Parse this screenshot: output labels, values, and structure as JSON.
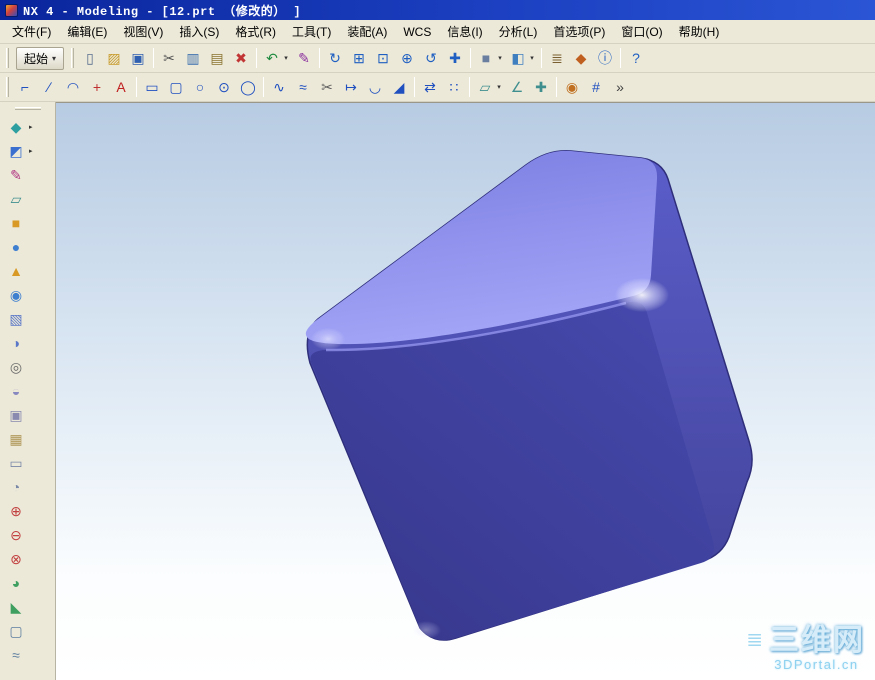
{
  "window": {
    "title": "NX 4 - Modeling - [12.prt （修改的） ]"
  },
  "menubar": {
    "items": [
      {
        "name": "menu-file",
        "label": "文件(F)"
      },
      {
        "name": "menu-edit",
        "label": "编辑(E)"
      },
      {
        "name": "menu-view",
        "label": "视图(V)"
      },
      {
        "name": "menu-insert",
        "label": "插入(S)"
      },
      {
        "name": "menu-format",
        "label": "格式(R)"
      },
      {
        "name": "menu-tools",
        "label": "工具(T)"
      },
      {
        "name": "menu-assemblies",
        "label": "装配(A)"
      },
      {
        "name": "menu-wcs",
        "label": "WCS"
      },
      {
        "name": "menu-information",
        "label": "信息(I)"
      },
      {
        "name": "menu-analysis",
        "label": "分析(L)"
      },
      {
        "name": "menu-preferences",
        "label": "首选项(P)"
      },
      {
        "name": "menu-window",
        "label": "窗口(O)"
      },
      {
        "name": "menu-help",
        "label": "帮助(H)"
      }
    ]
  },
  "toolbar_top": {
    "start_label": "起始",
    "start_arrow": "▾",
    "row1": [
      {
        "name": "new-button",
        "glyph": "▯",
        "color": "#5b7090"
      },
      {
        "name": "open-button",
        "glyph": "▨",
        "color": "#c89b2a"
      },
      {
        "name": "save-button",
        "glyph": "▣",
        "color": "#2f5fb0"
      },
      {
        "sep": true
      },
      {
        "name": "cut-button",
        "glyph": "✂",
        "color": "#555555"
      },
      {
        "name": "copy-button",
        "glyph": "▥",
        "color": "#3b6fae"
      },
      {
        "name": "paste-button",
        "glyph": "▤",
        "color": "#8a7430"
      },
      {
        "name": "delete-button",
        "glyph": "✖",
        "color": "#c23535"
      },
      {
        "sep": true
      },
      {
        "name": "undo-button",
        "glyph": "↶",
        "color": "#1f8a3f",
        "arrow": true
      },
      {
        "name": "pen-button",
        "glyph": "✎",
        "color": "#8a2f9e"
      },
      {
        "sep": true
      },
      {
        "name": "refresh-view-button",
        "glyph": "↻",
        "color": "#1f5fc2"
      },
      {
        "name": "fit-view-button",
        "glyph": "⊞",
        "color": "#1f5fc2"
      },
      {
        "name": "zoom-box-button",
        "glyph": "⊡",
        "color": "#1f5fc2"
      },
      {
        "name": "zoom-in-button",
        "glyph": "⊕",
        "color": "#1f5fc2"
      },
      {
        "name": "rotate-view-button",
        "glyph": "↺",
        "color": "#1f5fc2"
      },
      {
        "name": "pan-view-button",
        "glyph": "✚",
        "color": "#1f5fc2"
      },
      {
        "sep": true
      },
      {
        "name": "shaded-display-button",
        "glyph": "■",
        "color": "#6a7fa0",
        "arrow": true
      },
      {
        "name": "view-orientation-button",
        "glyph": "◧",
        "color": "#3f7fc0",
        "arrow": true
      },
      {
        "sep": true
      },
      {
        "name": "layer-settings-button",
        "glyph": "≣",
        "color": "#7a6030"
      },
      {
        "name": "wcs-display-button",
        "glyph": "◆",
        "color": "#c06020"
      },
      {
        "name": "info-button",
        "glyph": "ⓘ",
        "color": "#1f5fc2"
      },
      {
        "sep": true
      },
      {
        "name": "help-button",
        "glyph": "?",
        "color": "#1f5fc2"
      }
    ],
    "row2": [
      {
        "name": "profile-button",
        "glyph": "⌐",
        "color": "#2050c0"
      },
      {
        "name": "line-button",
        "glyph": "∕",
        "color": "#2050c0"
      },
      {
        "name": "arc-button",
        "glyph": "◠",
        "color": "#2050c0"
      },
      {
        "name": "point-button",
        "glyph": "+",
        "color": "#c03030"
      },
      {
        "name": "text-button",
        "glyph": "A",
        "color": "#c02020"
      },
      {
        "sep": true
      },
      {
        "name": "rectangle-button",
        "glyph": "▭",
        "color": "#2050c0"
      },
      {
        "name": "rounded-rectangle-button",
        "glyph": "▢",
        "color": "#2050c0"
      },
      {
        "name": "circle-button",
        "glyph": "○",
        "color": "#2050c0"
      },
      {
        "name": "circle-center-button",
        "glyph": "⊙",
        "color": "#2050c0"
      },
      {
        "name": "ellipse-button",
        "glyph": "◯",
        "color": "#2050c0"
      },
      {
        "sep": true
      },
      {
        "name": "spline-button",
        "glyph": "∿",
        "color": "#2050c0"
      },
      {
        "name": "offset-curve-button",
        "glyph": "≈",
        "color": "#2050c0"
      },
      {
        "name": "trim-curve-button",
        "glyph": "✂",
        "color": "#606060"
      },
      {
        "name": "extend-curve-button",
        "glyph": "↦",
        "color": "#2050c0"
      },
      {
        "name": "fillet-button",
        "glyph": "◡",
        "color": "#2050c0"
      },
      {
        "name": "chamfer-button",
        "glyph": "◢",
        "color": "#2050c0"
      },
      {
        "sep": true
      },
      {
        "name": "mirror-curve-button",
        "glyph": "⇄",
        "color": "#2050c0"
      },
      {
        "name": "pattern-curve-button",
        "glyph": "∷",
        "color": "#2050c0"
      },
      {
        "sep": true
      },
      {
        "name": "datum-plane-button",
        "glyph": "▱",
        "color": "#3f8f8f",
        "arrow": true
      },
      {
        "name": "datum-axis-button",
        "glyph": "∠",
        "color": "#3f8f8f"
      },
      {
        "name": "datum-csys-button",
        "glyph": "✚",
        "color": "#3f8f8f"
      },
      {
        "sep": true
      },
      {
        "name": "snap-point-button",
        "glyph": "◉",
        "color": "#c07020"
      },
      {
        "name": "grid-button",
        "glyph": "#",
        "color": "#2050c0"
      },
      {
        "name": "more-tools-button",
        "glyph": "»",
        "color": "#444444"
      }
    ]
  },
  "toolbar_left": {
    "items": [
      {
        "name": "extrude-flyout-button",
        "glyph": "◆",
        "color": "#2e9fa0",
        "arrow": true
      },
      {
        "name": "revolve-flyout-button",
        "glyph": "◩",
        "color": "#3a6fd0",
        "arrow": true
      },
      {
        "name": "sketch-button",
        "glyph": "✎",
        "color": "#b03580"
      },
      {
        "name": "datum-plane-button",
        "glyph": "▱",
        "color": "#3f8f8f"
      },
      {
        "name": "block-button",
        "glyph": "■",
        "color": "#d89a25"
      },
      {
        "name": "cylinder-button",
        "glyph": "●",
        "color": "#3f7fd0"
      },
      {
        "name": "cone-button",
        "glyph": "▲",
        "color": "#d89a25"
      },
      {
        "name": "sphere-button",
        "glyph": "◉",
        "color": "#3f7fd0"
      },
      {
        "name": "extrude-button",
        "glyph": "▧",
        "color": "#5b78c8"
      },
      {
        "name": "revolve-button",
        "glyph": "◑",
        "color": "#5b78c8"
      },
      {
        "name": "hole-button",
        "glyph": "◎",
        "color": "#6a6a6a"
      },
      {
        "name": "boss-button",
        "glyph": "◒",
        "color": "#8888c0"
      },
      {
        "name": "pocket-button",
        "glyph": "▣",
        "color": "#8a8ab0"
      },
      {
        "name": "pad-button",
        "glyph": "▦",
        "color": "#b0985a"
      },
      {
        "name": "slot-button",
        "glyph": "▭",
        "color": "#7a88a8"
      },
      {
        "name": "groove-button",
        "glyph": "◔",
        "color": "#7a88a8"
      },
      {
        "name": "unite-button",
        "glyph": "⊕",
        "color": "#c24040"
      },
      {
        "name": "subtract-button",
        "glyph": "⊖",
        "color": "#c24040"
      },
      {
        "name": "intersect-button",
        "glyph": "⊗",
        "color": "#c24040"
      },
      {
        "name": "edge-blend-button",
        "glyph": "◕",
        "color": "#3f9f60"
      },
      {
        "name": "chamfer-button",
        "glyph": "◣",
        "color": "#3f9f60"
      },
      {
        "name": "shell-button",
        "glyph": "▢",
        "color": "#5f7fa0"
      },
      {
        "name": "thread-button",
        "glyph": "≈",
        "color": "#5f7fa0"
      }
    ]
  },
  "viewport": {
    "bg_top": "#b7cbe2",
    "bg_bottom": "#ffffff",
    "watermark": {
      "icon": "≣",
      "title": "三维网",
      "subtitle": "3DPortal.cn"
    }
  },
  "cube": {
    "colors": {
      "top_back": "#7b7de2",
      "top_front": "#a2a4f6",
      "front_top": "#474aae",
      "front_bottom": "#36368a",
      "side_top": "#5b5dca",
      "side_bottom": "#404195",
      "outline": "#2e2e7a",
      "edge_highlight": "#9b9df5"
    }
  }
}
